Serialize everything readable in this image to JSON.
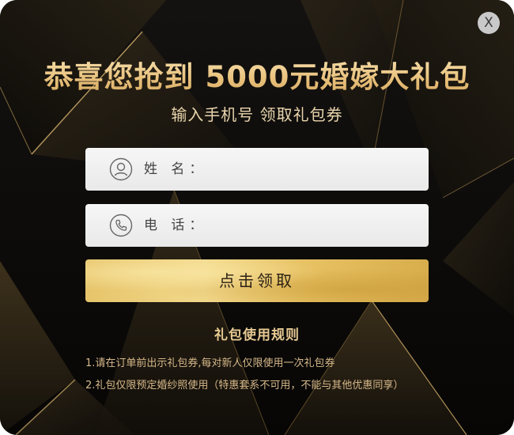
{
  "dialog": {
    "close_label": "X",
    "title": "恭喜您抢到 5000元婚嫁大礼包",
    "subtitle": "输入手机号 领取礼包券"
  },
  "form": {
    "name_label": "姓 名：",
    "name_icon": "user-icon",
    "name_value": "",
    "phone_label": "电 话：",
    "phone_icon": "phone-icon",
    "phone_value": "",
    "submit_label": "点击领取"
  },
  "rules": {
    "title": "礼包使用规则",
    "items": [
      "1.请在订单前出示礼包券,每对新人仅限使用一次礼包券",
      "2.礼包仅限预定婚纱照使用（特惠套系不可用，不能与其他优惠同享）"
    ]
  },
  "colors": {
    "background": "#0b0a08",
    "gold_text": "#ecc888",
    "button_gold": "#e6c46a",
    "field_bg": "#f2f2f2",
    "close_bg": "#c9c9c9"
  }
}
